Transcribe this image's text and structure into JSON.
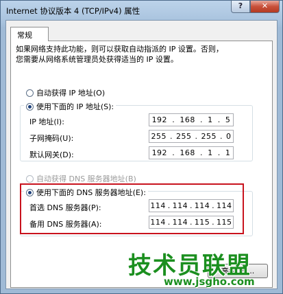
{
  "window": {
    "title": "Internet 协议版本 4 (TCP/IPv4) 属性",
    "help_label": "?",
    "close_label": "✕"
  },
  "tabs": [
    {
      "label": "常规"
    }
  ],
  "description": {
    "line1": "如果网络支持此功能，则可以获取自动指派的 IP 设置。否则，",
    "line2": "您需要从网络系统管理员处获得适当的 IP 设置。"
  },
  "ip": {
    "auto_label": "自动获得 IP 地址(O)",
    "manual_label": "使用下面的 IP 地址(S):",
    "auto_checked": false,
    "manual_checked": true,
    "fields": [
      {
        "label": "IP 地址(I):",
        "octets": [
          "192",
          "168",
          "1",
          "5"
        ]
      },
      {
        "label": "子网掩码(U):",
        "octets": [
          "255",
          "255",
          "255",
          "0"
        ]
      },
      {
        "label": "默认网关(D):",
        "octets": [
          "192",
          "168",
          "1",
          "1"
        ]
      }
    ]
  },
  "dns": {
    "auto_label": "自动获得 DNS 服务器地址(B)",
    "manual_label": "使用下面的 DNS 服务器地址(E):",
    "auto_checked": false,
    "manual_checked": true,
    "fields": [
      {
        "label": "首选 DNS 服务器(P):",
        "octets": [
          "114",
          "114",
          "114",
          "114"
        ]
      },
      {
        "label": "备用 DNS 服务器(A):",
        "octets": [
          "114",
          "114",
          "115",
          "115"
        ]
      }
    ]
  },
  "advanced_label": "高级(V)...",
  "watermark": {
    "text": "技术员联盟",
    "url": "www.jsgho.com"
  },
  "colors": {
    "highlight": "#c8121d",
    "watermark": "#1b8f1f"
  }
}
